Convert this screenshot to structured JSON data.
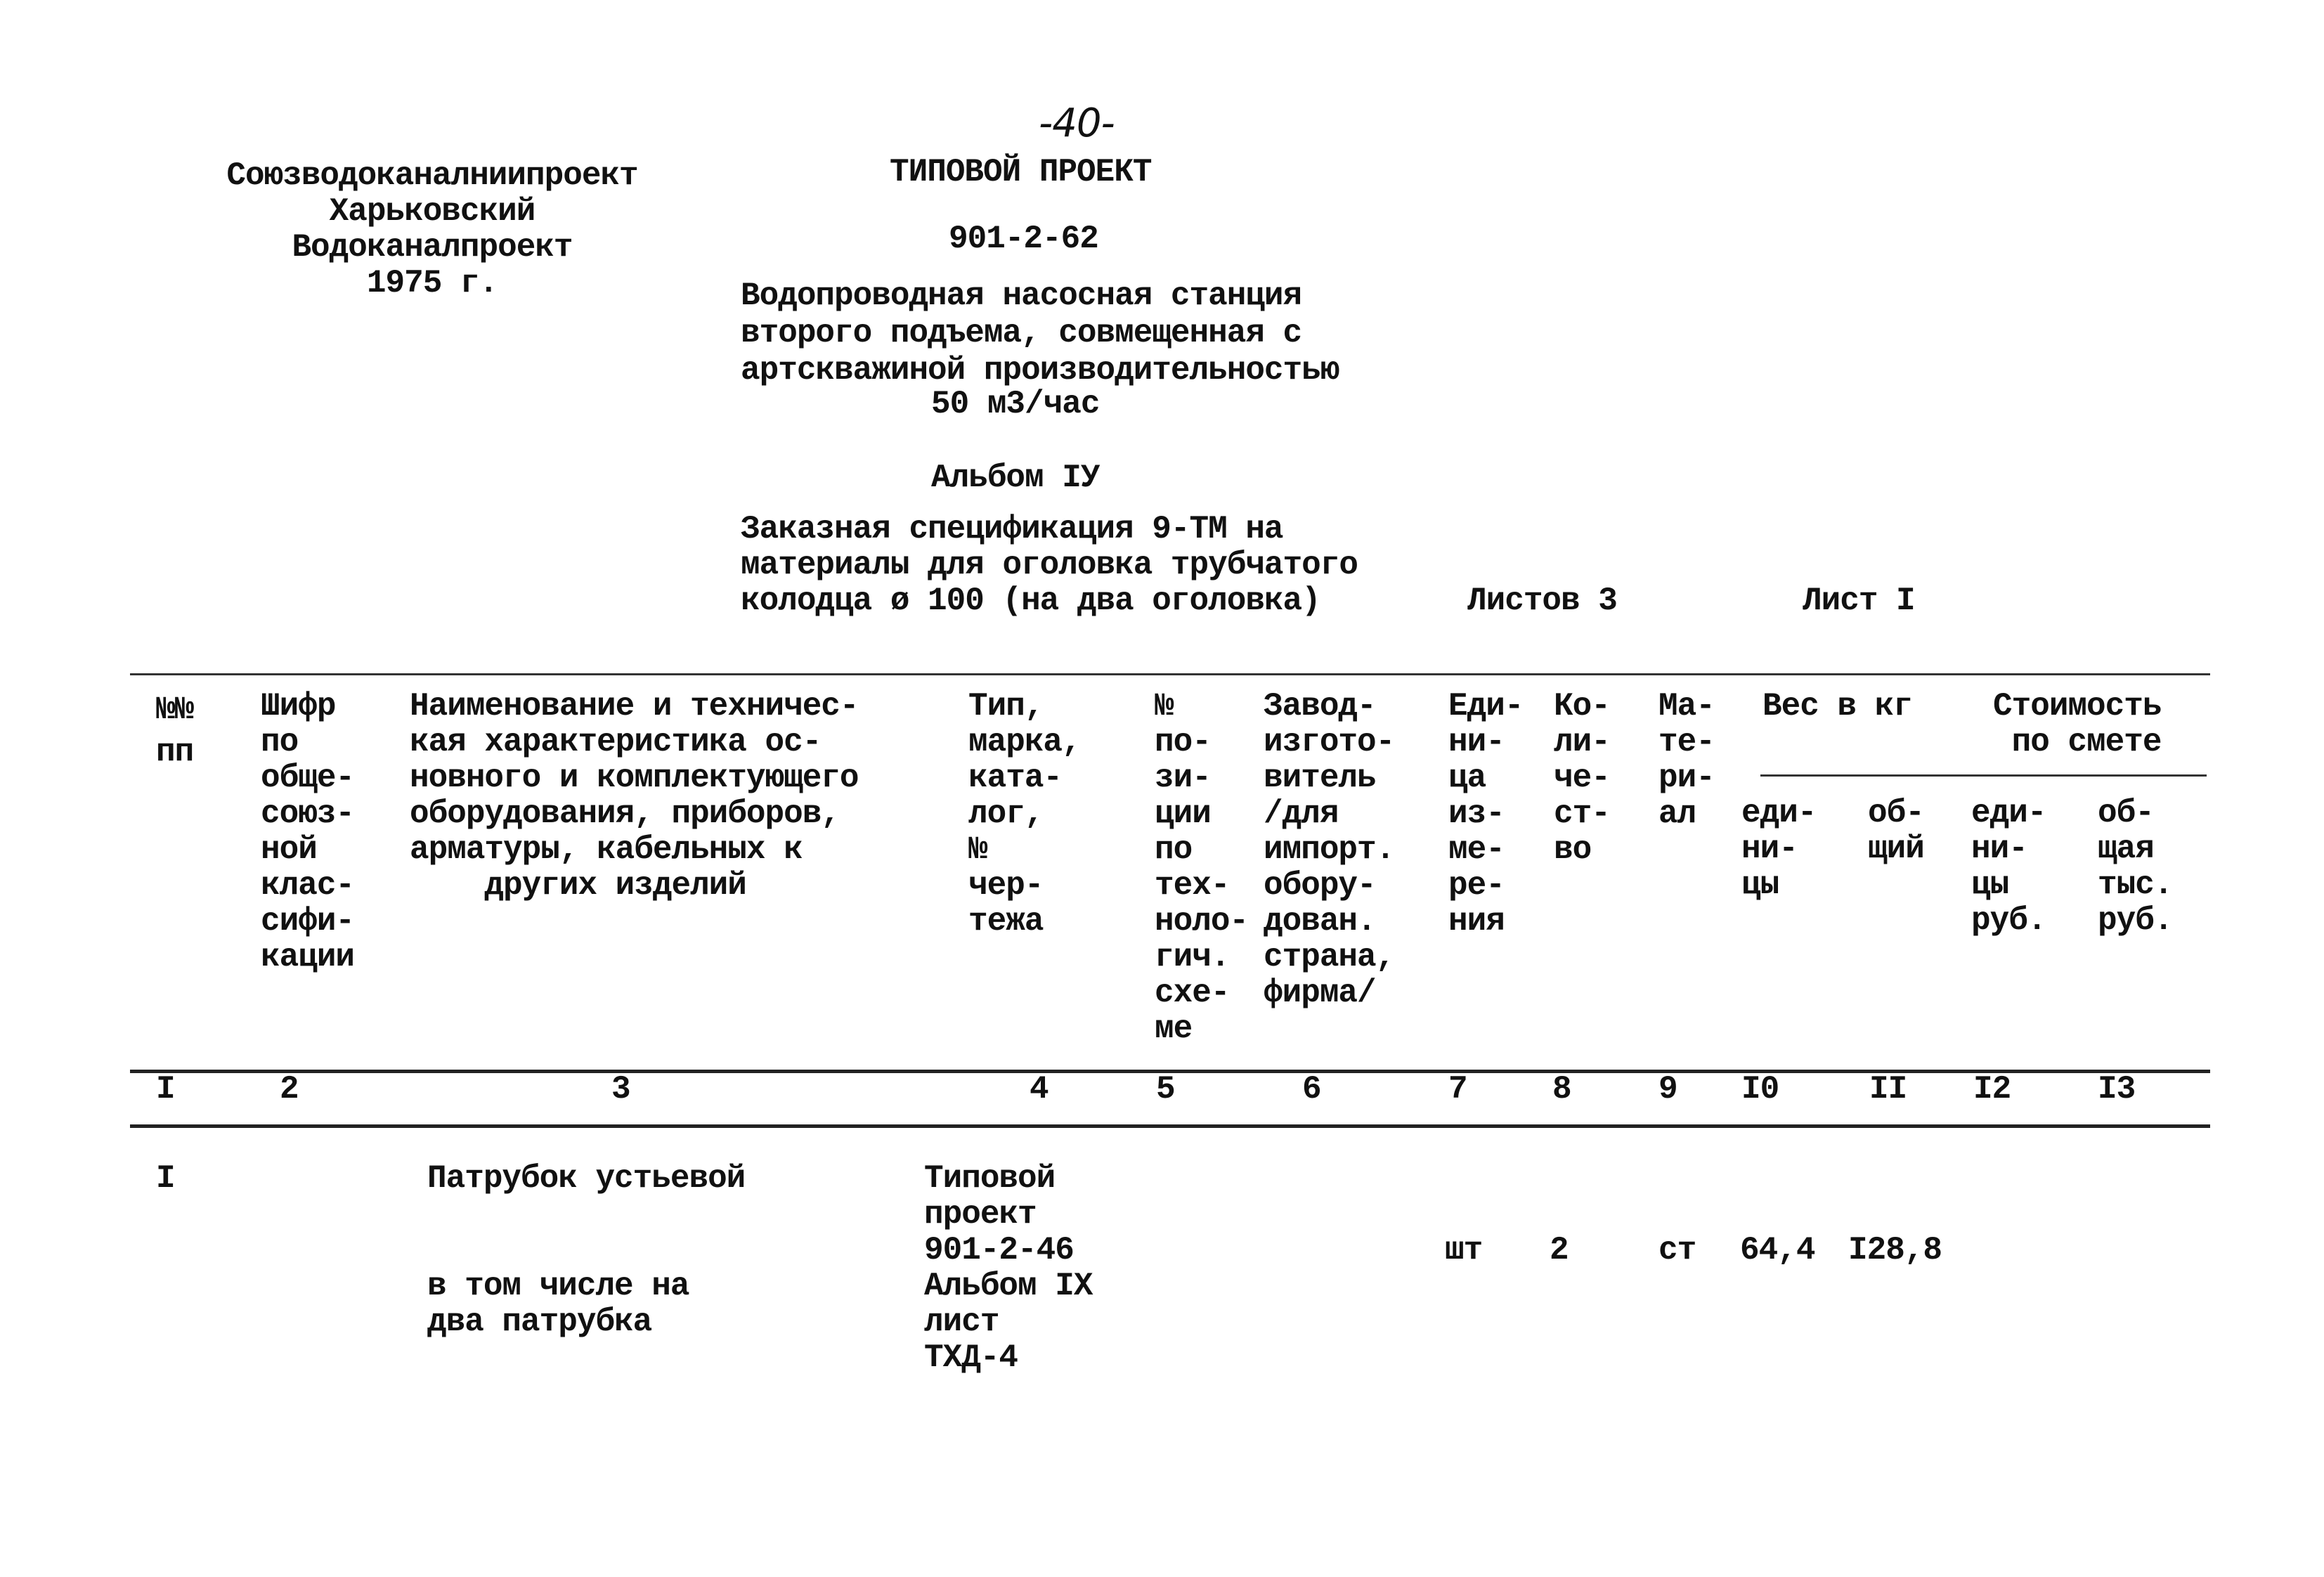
{
  "page_number": "-40-",
  "org": {
    "lines": "Союзводоканалниипроект\nХарьковский\nВодоканалпроект\n1975 г."
  },
  "project": {
    "type_label": "ТИПОВОЙ ПРОЕКТ",
    "number": "901-2-62",
    "description": "Водопроводная насосная станция\nвторого подъема, совмещенная с\nартскважиной производительностью",
    "capacity": "50 м3/час",
    "album": "Альбом IУ",
    "spec_title": "Заказная спецификация 9-ТМ на\nматериалы для оголовка трубчатого\nколодца ø 100 (на два оголовка)",
    "sheets_total": "Листов 3",
    "sheet": "Лист I"
  },
  "table": {
    "headers": [
      "№№\nпп",
      "Шифр\nпо\nобще-\nсоюз-\nной\nклас-\nсифи-\nкации",
      "Наименование и техничес-\nкая характеристика ос-\nновного и комплектующего\nоборудования, приборов,\nарматуры, кабельных к\n    других изделий",
      "Тип,\nмарка,\nката-\nлог,\n№\nчер-\nтежа",
      "№\nпо-\nзи-\nции\nпо\nтех-\nноло-\nгич.\nсхе-\nме",
      "Завод-\nизгото-\nвитель\n/для\nимпорт.\nобору-\nдован.\nстрана,\nфирма/",
      "Еди-\nни-\nца\nиз-\nме-\nре-\nния",
      "Ко-\nли-\nче-\nст-\nво",
      "Ма-\nте-\nри-\nал"
    ],
    "group_weight": "Вес в кг",
    "group_cost": "Стоимость\n по смете",
    "sub_headers": [
      "еди-\nни-\nцы",
      "об-\nщий",
      "еди-\nни-\nцы\nруб.",
      "об-\nщая\nтыс.\nруб."
    ],
    "column_numbers": [
      "I",
      "2",
      "3",
      "4",
      "5",
      "6",
      "7",
      "8",
      "9",
      "I0",
      "II",
      "I2",
      "I3"
    ],
    "rows": [
      {
        "num": "I",
        "name": "Патрубок устьевой",
        "name_note": "в том числе на\nдва патрубка",
        "type": "Типовой\nпроект\n901-2-46\nАльбом IX\nлист\nТХД-4",
        "unit": "шт",
        "qty": "2",
        "material": "ст",
        "weight_unit": "64,4",
        "weight_total": "I28,8"
      }
    ]
  }
}
